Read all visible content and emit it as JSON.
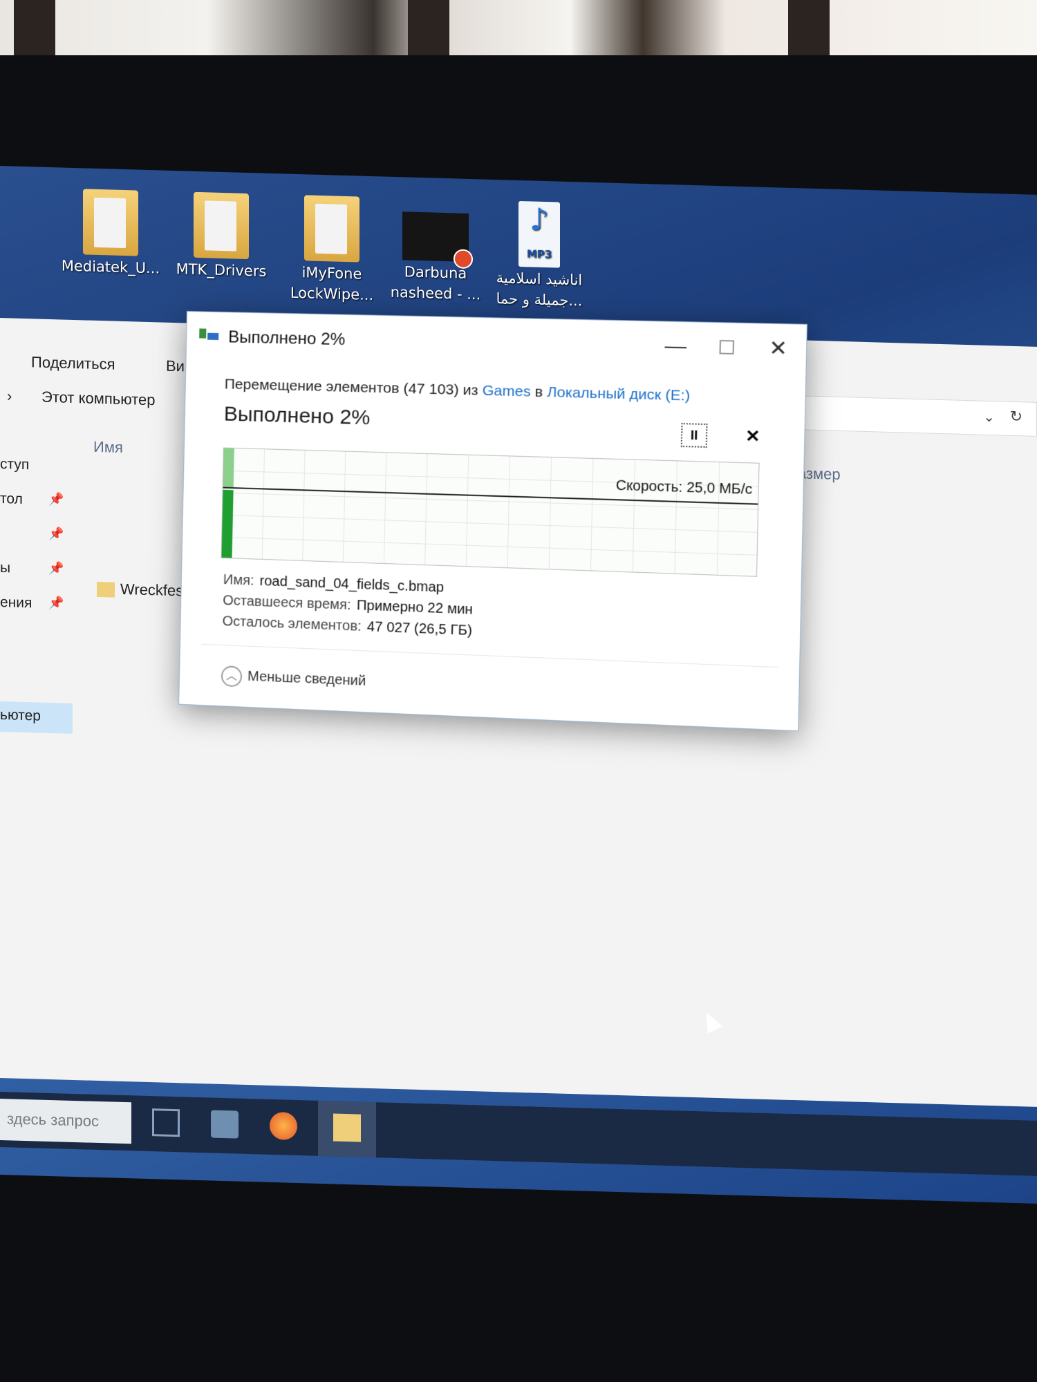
{
  "desktop": {
    "icons": [
      {
        "label": "Mediatek_U...",
        "icon": "folder-icon"
      },
      {
        "label": "MTK_Drivers",
        "icon": "folder-icon"
      },
      {
        "label": "iMyFone LockWipe...",
        "icon": "folder-icon"
      },
      {
        "label": "Darbuna nasheed - ...",
        "icon": "video-file-icon"
      },
      {
        "label": "اناشيد اسلامية جميلة و حما...",
        "icon": "mp3-file-icon",
        "badge": "MP3"
      }
    ]
  },
  "explorer": {
    "ribbon": {
      "share": "Поделиться",
      "view_partial": "Ви"
    },
    "breadcrumb": "Этот компьютер",
    "columns": {
      "name": "Имя",
      "size": "Размер"
    },
    "nav_items": [
      "ступ",
      "тол",
      "",
      "ы",
      "ения",
      "ьютер"
    ],
    "file_partial": "Wreckfes"
  },
  "dialog": {
    "title": "Выполнено 2%",
    "operation_prefix": "Перемещение элементов (47 103) из",
    "source": "Games",
    "in_word": "в",
    "destination": "Локальный диск (E:)",
    "percent_label": "Выполнено 2%",
    "progress_percent": 2,
    "speed": "Скорость: 25,0 МБ/с",
    "name_label": "Имя:",
    "name_value": "road_sand_04_fields_c.bmap",
    "time_label": "Оставшееся время:",
    "time_value": "Примерно 22 мин",
    "items_label": "Осталось элементов:",
    "items_value": "47 027 (26,5 ГБ)",
    "less_details": "Меньше сведений",
    "pause_glyph": "II",
    "cancel_glyph": "✕",
    "close_glyph": "✕",
    "minimize_glyph": "—"
  },
  "taskbar": {
    "search_placeholder": "здесь запрос"
  }
}
